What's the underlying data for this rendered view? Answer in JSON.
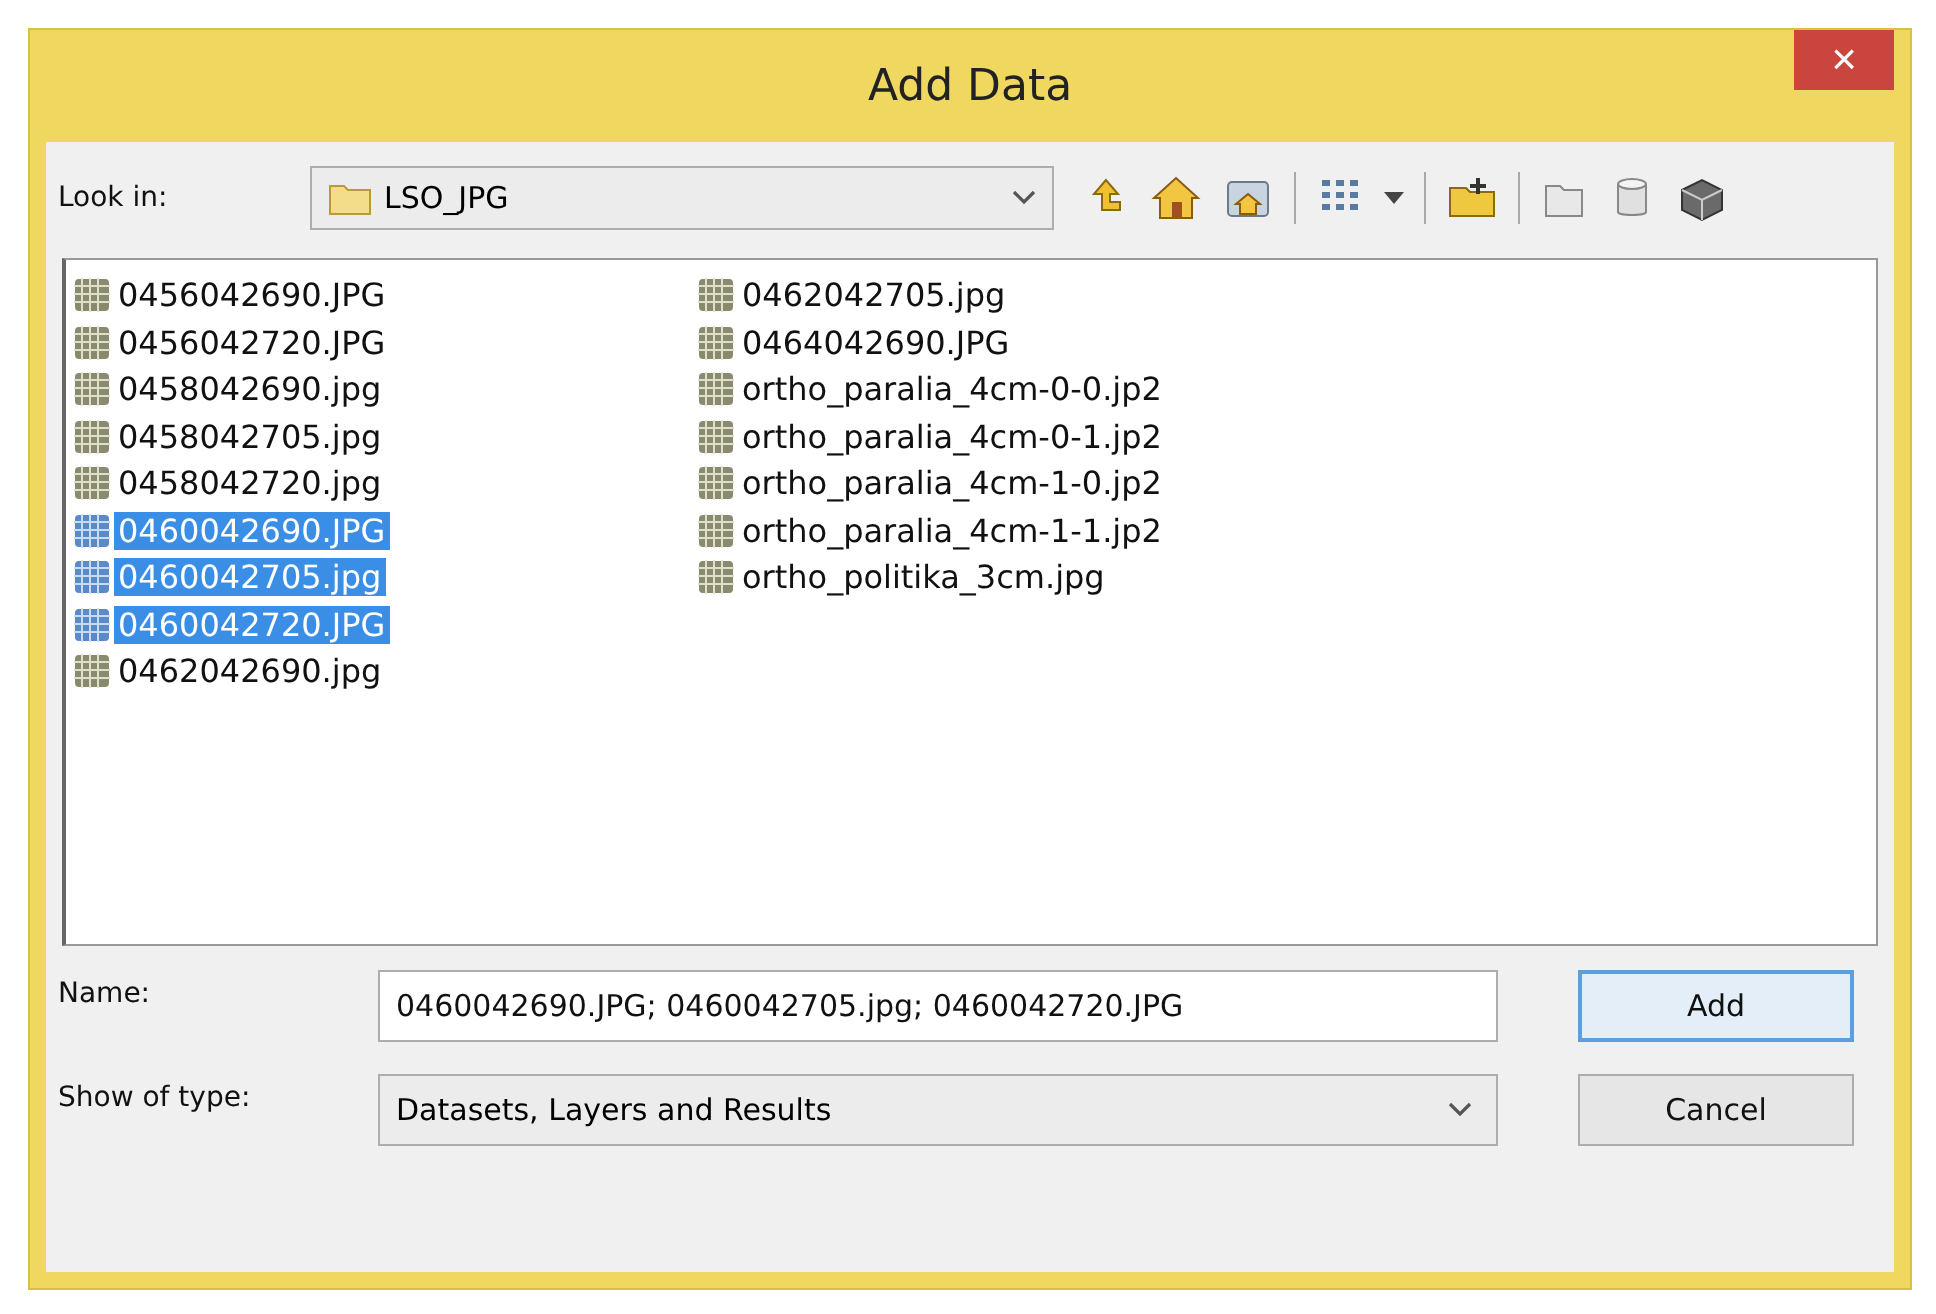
{
  "window": {
    "title": "Add Data",
    "close_glyph": "×"
  },
  "look_in": {
    "label": "Look in:",
    "value": "LSO_JPG"
  },
  "files": [
    {
      "name": "0456042690.JPG",
      "selected": false
    },
    {
      "name": "0456042720.JPG",
      "selected": false
    },
    {
      "name": "0458042690.jpg",
      "selected": false
    },
    {
      "name": "0458042705.jpg",
      "selected": false
    },
    {
      "name": "0458042720.jpg",
      "selected": false
    },
    {
      "name": "0460042690.JPG",
      "selected": true
    },
    {
      "name": "0460042705.jpg",
      "selected": true
    },
    {
      "name": "0460042720.JPG",
      "selected": true
    },
    {
      "name": "0462042690.jpg",
      "selected": false
    },
    {
      "name": "0462042705.jpg",
      "selected": false
    },
    {
      "name": "0464042690.JPG",
      "selected": false
    },
    {
      "name": "ortho_paralia_4cm-0-0.jp2",
      "selected": false
    },
    {
      "name": "ortho_paralia_4cm-0-1.jp2",
      "selected": false
    },
    {
      "name": "ortho_paralia_4cm-1-0.jp2",
      "selected": false
    },
    {
      "name": "ortho_paralia_4cm-1-1.jp2",
      "selected": false
    },
    {
      "name": "ortho_politika_3cm.jpg",
      "selected": false
    }
  ],
  "name_field": {
    "label": "Name:",
    "value": "0460042690.JPG; 0460042705.jpg; 0460042720.JPG"
  },
  "type_field": {
    "label": "Show of type:",
    "value": "Datasets, Layers and Results"
  },
  "buttons": [
    "Add",
    "Cancel"
  ]
}
